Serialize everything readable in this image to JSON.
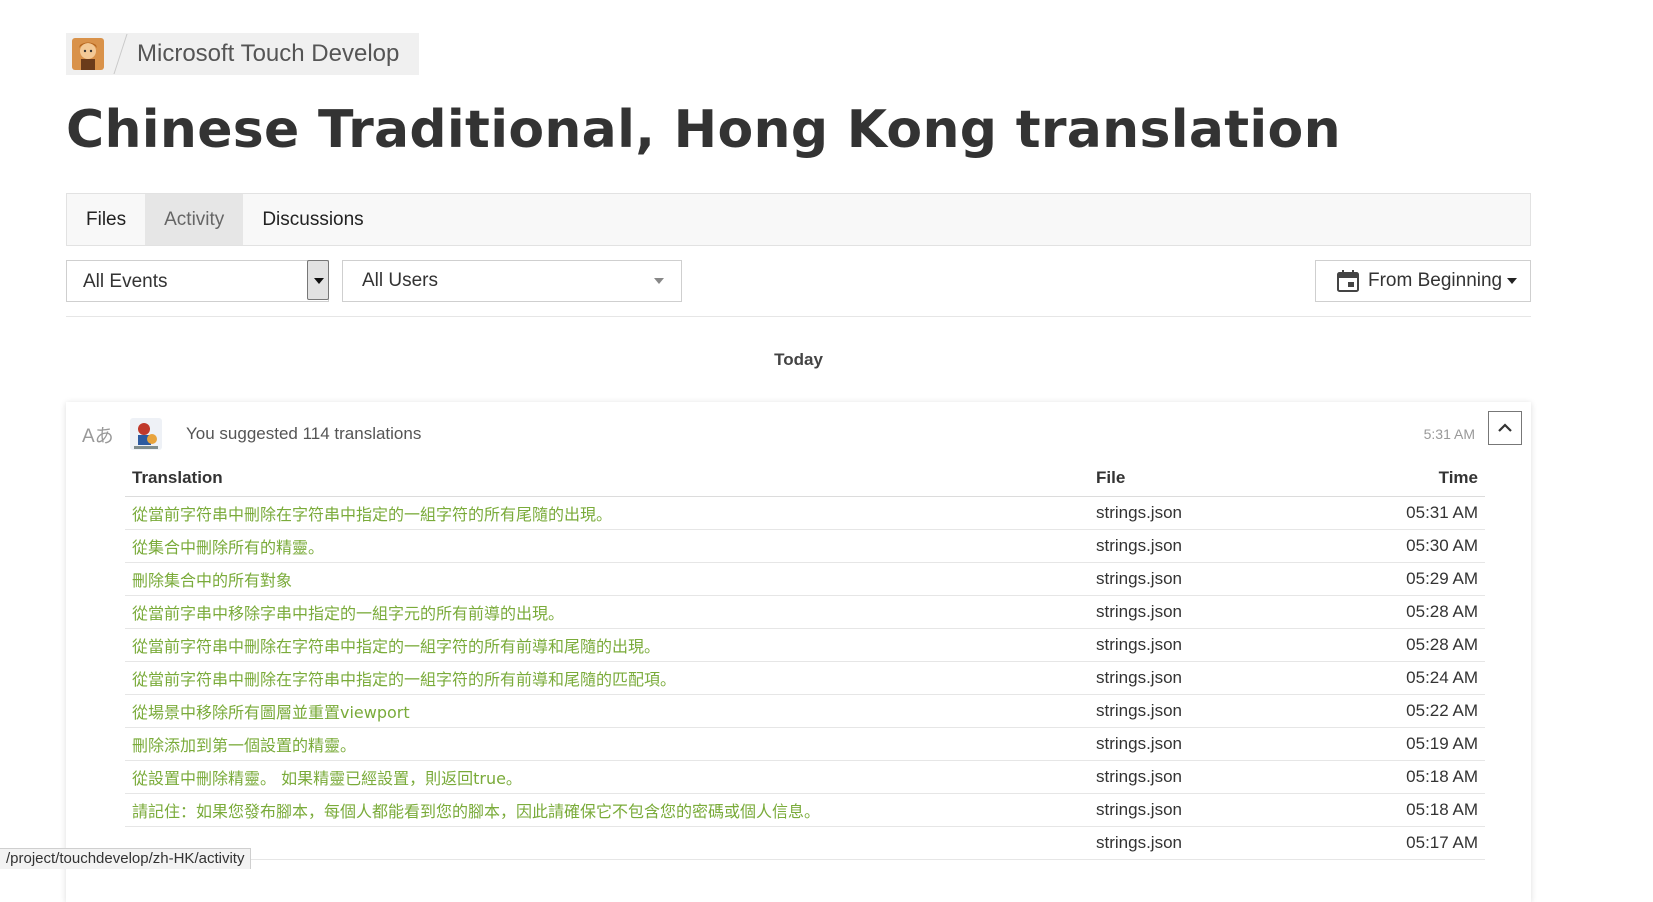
{
  "breadcrumb": {
    "org_name": "Microsoft Touch Develop"
  },
  "page": {
    "title": "Chinese Traditional, Hong Kong translation"
  },
  "tabs": [
    {
      "label": "Files",
      "active": false
    },
    {
      "label": "Activity",
      "active": true
    },
    {
      "label": "Discussions",
      "active": false
    }
  ],
  "filters": {
    "events_value": "All Events",
    "users_value": "All Users",
    "date_range": "From Beginning"
  },
  "group_label": "Today",
  "activity": {
    "summary": "You suggested 114 translations",
    "time": "5:31 AM",
    "translate_glyph": "Aあ",
    "table": {
      "headers": {
        "translation": "Translation",
        "file": "File",
        "time": "Time"
      },
      "rows": [
        {
          "translation": "從當前字符串中刪除在字符串中指定的一組字符的所有尾隨的出現。",
          "file": "strings.json",
          "time": "05:31 AM"
        },
        {
          "translation": "從集合中刪除所有的精靈。",
          "file": "strings.json",
          "time": "05:30 AM"
        },
        {
          "translation": "刪除集合中的所有對象",
          "file": "strings.json",
          "time": "05:29 AM"
        },
        {
          "translation": "從當前字串中移除字串中指定的一組字元的所有前導的出現。",
          "file": "strings.json",
          "time": "05:28 AM"
        },
        {
          "translation": "從當前字符串中刪除在字符串中指定的一組字符的所有前導和尾隨的出現。",
          "file": "strings.json",
          "time": "05:28 AM"
        },
        {
          "translation": "從當前字符串中刪除在字符串中指定的一組字符的所有前導和尾隨的匹配項。",
          "file": "strings.json",
          "time": "05:24 AM"
        },
        {
          "translation": "從場景中移除所有圖層並重置viewport",
          "file": "strings.json",
          "time": "05:22 AM"
        },
        {
          "translation": "刪除添加到第一個設置的精靈。",
          "file": "strings.json",
          "time": "05:19 AM"
        },
        {
          "translation": "從設置中刪除精靈。 如果精靈已經設置，則返回true。",
          "file": "strings.json",
          "time": "05:18 AM"
        },
        {
          "translation": "請記住：如果您發布腳本，每個人都能看到您的腳本，因此請確保它不包含您的密碼或個人信息。",
          "file": "strings.json",
          "time": "05:18 AM"
        },
        {
          "translation": "",
          "file": "strings.json",
          "time": "05:17 AM"
        }
      ]
    }
  },
  "status_bar": {
    "url": "/project/touchdevelop/zh-HK/activity"
  }
}
